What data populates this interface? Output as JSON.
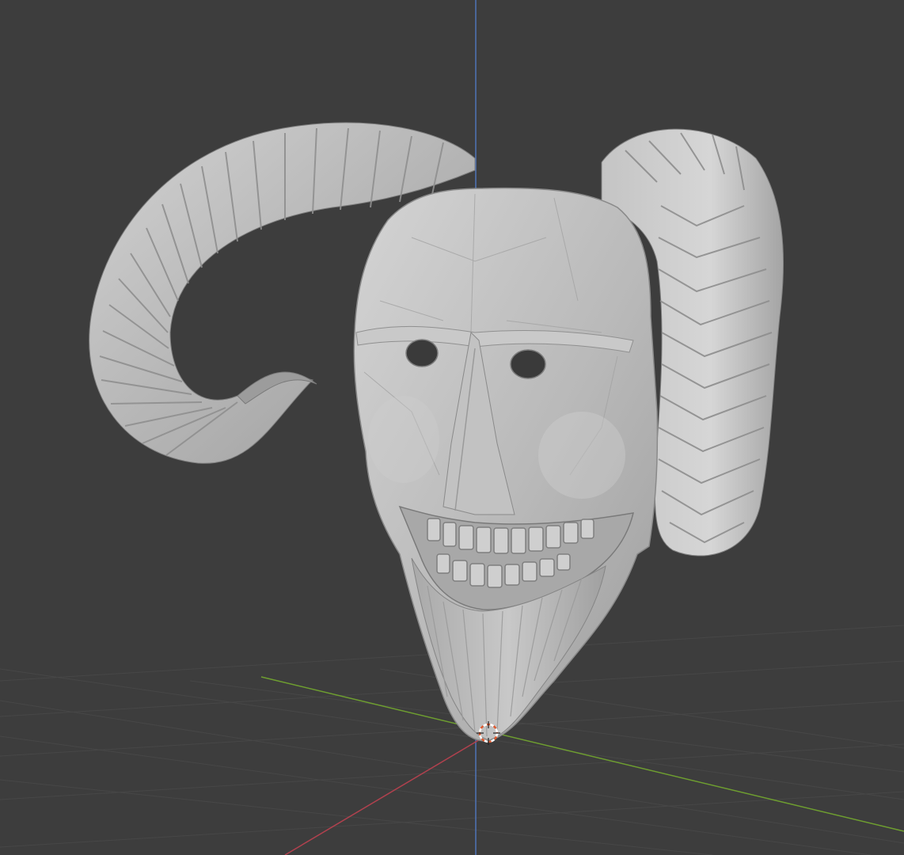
{
  "viewport": {
    "background": "#3d3d3d",
    "grid_color": "#464646",
    "axis_x_color": "#b1414e",
    "axis_y_color": "#6e9e30",
    "axis_z_color": "#4f74b8",
    "model_color": "#b9b9b9",
    "model_shadow_color": "#8c8c8c",
    "model_highlight_color": "#dcdcdc",
    "origin_marker_colors": [
      "#ffffff",
      "#e0582d"
    ],
    "object": "demon-mask-with-ram-horns",
    "icons": [
      "3d-cursor-icon"
    ]
  }
}
